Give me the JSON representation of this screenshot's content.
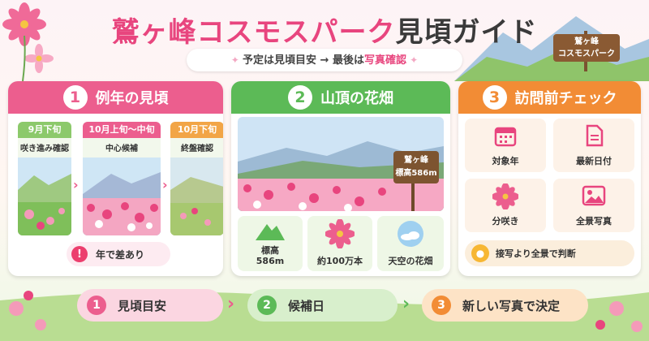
{
  "header": {
    "title_part1": "鷲ヶ峰コスモスパーク",
    "title_part2": "見頃ガイド",
    "subtitle_part1": "予定は見頃目安 → 最後は",
    "subtitle_part2": "写真確認",
    "sign_line1": "鷲ヶ峰",
    "sign_line2": "コスモスパーク"
  },
  "panel1": {
    "number": "1",
    "title": "例年の見頃",
    "seasons": [
      {
        "tag": "9月下旬",
        "caption": "咲き進み確認"
      },
      {
        "tag": "10月上旬〜中旬",
        "caption": "中心候補"
      },
      {
        "tag": "10月下旬",
        "caption": "終盤確認"
      }
    ],
    "note_icon": "!",
    "note": "年で差あり"
  },
  "panel2": {
    "number": "2",
    "title": "山頂の花畑",
    "sign_line1": "鷲ヶ峰",
    "sign_line2": "標高586m",
    "stats": [
      {
        "icon": "mountain-icon",
        "label_line1": "標高",
        "label_line2": "586m"
      },
      {
        "icon": "cosmos-flower-icon",
        "label_line1": "約100万本",
        "label_line2": ""
      },
      {
        "icon": "sky-icon",
        "label_line1": "天空の花畑",
        "label_line2": ""
      }
    ]
  },
  "panel3": {
    "number": "3",
    "title": "訪問前チェック",
    "checks": [
      {
        "icon": "calendar-icon",
        "label": "対象年"
      },
      {
        "icon": "document-icon",
        "label": "最新日付"
      },
      {
        "icon": "flower-icon",
        "label": "分咲き"
      },
      {
        "icon": "image-icon",
        "label": "全景写真"
      }
    ],
    "tip": "接写より全景で判断"
  },
  "flow": [
    {
      "number": "1",
      "label": "見頃目安"
    },
    {
      "number": "2",
      "label": "候補日"
    },
    {
      "number": "3",
      "label": "新しい写真で決定"
    }
  ],
  "colors": {
    "pink": "#ec5e8e",
    "green": "#5cba57",
    "orange": "#f28c35"
  }
}
